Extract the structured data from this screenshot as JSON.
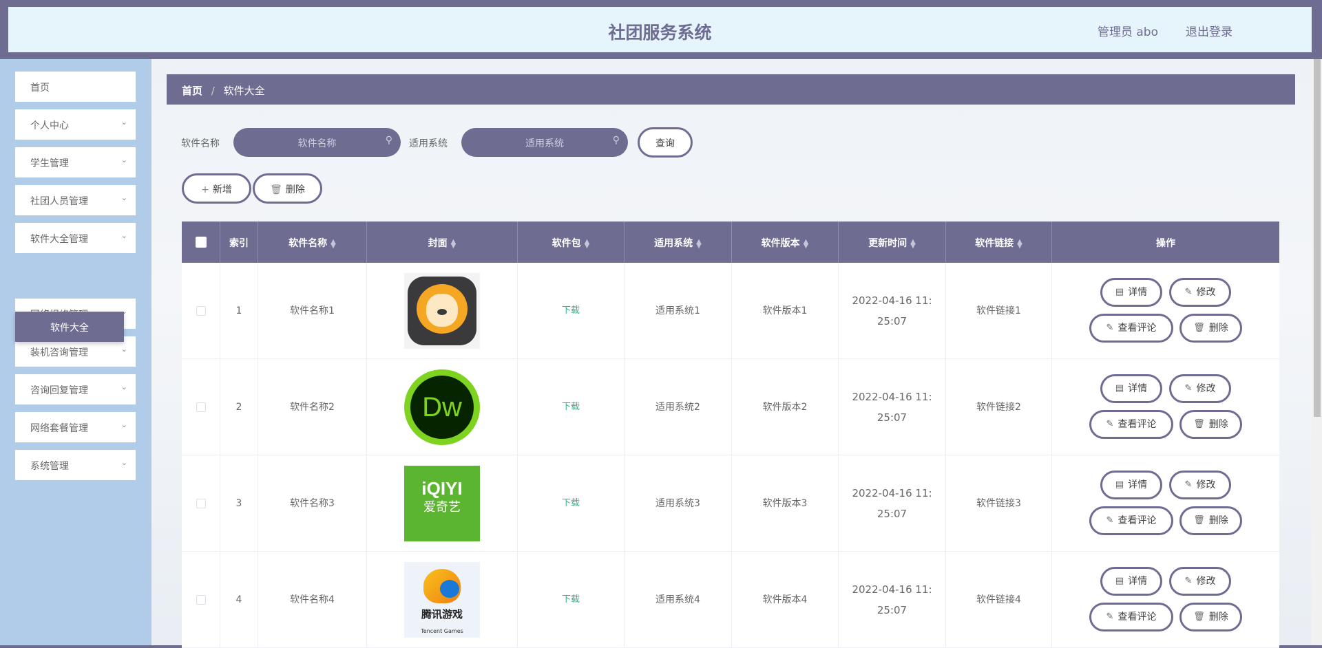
{
  "header": {
    "title": "社团服务系统",
    "user": "管理员 abo",
    "logout": "退出登录"
  },
  "sidebar": {
    "items": [
      {
        "label": "首页",
        "expandable": false
      },
      {
        "label": "个人中心",
        "expandable": true
      },
      {
        "label": "学生管理",
        "expandable": true
      },
      {
        "label": "社团人员管理",
        "expandable": true
      },
      {
        "label": "软件大全管理",
        "expandable": true
      },
      {
        "label": "网络报修管理",
        "expandable": true
      },
      {
        "label": "装机咨询管理",
        "expandable": true
      },
      {
        "label": "咨询回复管理",
        "expandable": true
      },
      {
        "label": "网络套餐管理",
        "expandable": true
      },
      {
        "label": "系统管理",
        "expandable": true
      }
    ],
    "active_sub": "软件大全"
  },
  "breadcrumb": {
    "home": "首页",
    "sep": "/",
    "current": "软件大全"
  },
  "search": {
    "name_label": "软件名称",
    "name_placeholder": "软件名称",
    "sys_label": "适用系统",
    "sys_placeholder": "适用系统",
    "query": "查询"
  },
  "toolbar": {
    "add": "新增",
    "delete": "删除"
  },
  "table": {
    "columns": [
      "索引",
      "软件名称",
      "封面",
      "软件包",
      "适用系统",
      "软件版本",
      "更新时间",
      "软件链接",
      "操作"
    ],
    "rows": [
      {
        "index": "1",
        "name": "软件名称1",
        "cover": "lion-app-icon",
        "package": "下载",
        "system": "适用系统1",
        "version": "软件版本1",
        "time": "2022-04-16 11:25:07",
        "link": "软件链接1"
      },
      {
        "index": "2",
        "name": "软件名称2",
        "cover": "dreamweaver-icon",
        "cover_text": "Dw",
        "package": "下载",
        "system": "适用系统2",
        "version": "软件版本2",
        "time": "2022-04-16 11:25:07",
        "link": "软件链接2"
      },
      {
        "index": "3",
        "name": "软件名称3",
        "cover": "iqiyi-icon",
        "cover_text": "爱奇艺",
        "package": "下载",
        "system": "适用系统3",
        "version": "软件版本3",
        "time": "2022-04-16 11:25:07",
        "link": "软件链接3"
      },
      {
        "index": "4",
        "name": "软件名称4",
        "cover": "tencent-games-icon",
        "cover_text": "腾讯游戏",
        "package": "下载",
        "system": "适用系统4",
        "version": "软件版本4",
        "time": "2022-04-16 11:25:07",
        "link": "软件链接4"
      }
    ],
    "actions": {
      "detail": "详情",
      "edit": "修改",
      "comments": "查看评论",
      "delete": "删除"
    }
  },
  "colors": {
    "primary": "#6e6c91",
    "header_bg": "#e6f4fc",
    "sidebar_bg": "#b0cce9",
    "download": "#31b28d"
  }
}
